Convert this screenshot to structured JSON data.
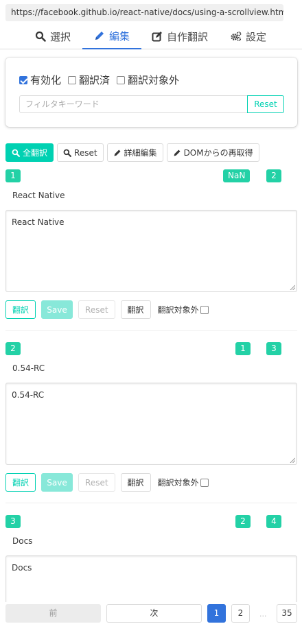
{
  "url": "https://facebook.github.io/react-native/docs/using-a-scrollview.html",
  "tabs": [
    {
      "label": "選択",
      "icon": "search-icon"
    },
    {
      "label": "編集",
      "icon": "pencil-icon"
    },
    {
      "label": "自作翻訳",
      "icon": "edit-icon"
    },
    {
      "label": "設定",
      "icon": "gears-icon"
    }
  ],
  "active_tab": "編集",
  "filters": {
    "enabled_label": "有効化",
    "enabled_checked": true,
    "translated_label": "翻訳済",
    "translated_checked": false,
    "excluded_label": "翻訳対象外",
    "excluded_checked": false,
    "keyword_placeholder": "フィルタキーワード",
    "reset_label": "Reset"
  },
  "toolbar": {
    "translate_all": "全翻訳",
    "reset": "Reset",
    "detail_edit": "詳細編集",
    "refetch_dom": "DOMからの再取得"
  },
  "entries": [
    {
      "index": "1",
      "prev": "NaN",
      "next": "2",
      "original": "React Native",
      "text": "React Native"
    },
    {
      "index": "2",
      "prev": "1",
      "next": "3",
      "original": "0.54-RC",
      "text": "0.54-RC"
    },
    {
      "index": "3",
      "prev": "2",
      "next": "4",
      "original": "Docs",
      "text": "Docs"
    }
  ],
  "entry_buttons": {
    "translate": "翻訳",
    "save": "Save",
    "reset": "Reset",
    "translate2": "翻訳",
    "exclude_label": "翻訳対象外"
  },
  "pager": {
    "prev": "前",
    "next": "次",
    "pages": [
      "1",
      "2"
    ],
    "ellipsis": "...",
    "last": "35",
    "current": "1"
  },
  "colors": {
    "accent": "#3273dc",
    "primary": "#00d1b2",
    "tag": "#23d1a6"
  }
}
